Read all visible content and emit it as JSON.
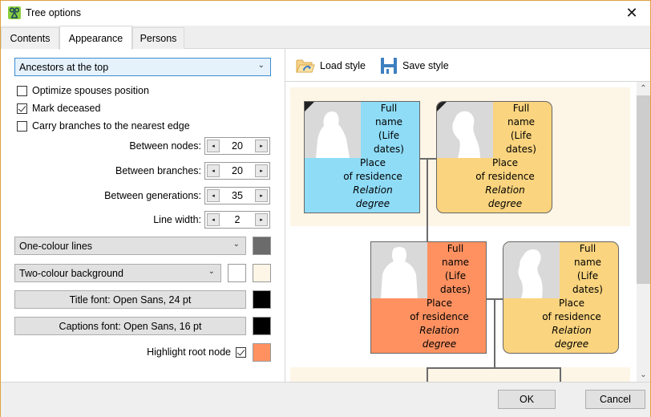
{
  "window": {
    "title": "Tree options",
    "close_glyph": "✕",
    "app_icon": "tree-options-app-icon"
  },
  "tabs": [
    {
      "label": "Contents",
      "active": false
    },
    {
      "label": "Appearance",
      "active": true
    },
    {
      "label": "Persons",
      "active": false
    }
  ],
  "appearance": {
    "layout_select": {
      "value": "Ancestors at the top"
    },
    "checkboxes": [
      {
        "label": "Optimize spouses position",
        "checked": false
      },
      {
        "label": "Mark deceased",
        "checked": true
      },
      {
        "label": "Carry branches to the nearest edge",
        "checked": false
      }
    ],
    "spinners": [
      {
        "label": "Between nodes:",
        "value": "20"
      },
      {
        "label": "Between branches:",
        "value": "20"
      },
      {
        "label": "Between generations:",
        "value": "35"
      },
      {
        "label": "Line width:",
        "value": "2"
      }
    ],
    "lines_select": {
      "value": "One-colour lines",
      "color": "#6b6b6b"
    },
    "background_select": {
      "value": "Two-colour background",
      "color1": "#ffffff",
      "color2": "#fdf5e6"
    },
    "title_font_button": {
      "label": "Title font: Open Sans, 24 pt",
      "color": "#000000"
    },
    "captions_font_button": {
      "label": "Captions font: Open Sans, 16 pt",
      "color": "#000000"
    },
    "highlight_root": {
      "label": "Highlight root node",
      "checked": true,
      "color": "#ff9161"
    }
  },
  "preview": {
    "toolbar": {
      "load_label": "Load style",
      "save_label": "Save style"
    },
    "node_text": {
      "line1": "Full",
      "line2": "name",
      "line3": "(Life",
      "line4": "dates)",
      "line5": "Place",
      "line6": "of residence",
      "line7": "Relation",
      "line8": "degree"
    },
    "colors": {
      "male": "#8fdcf7",
      "female": "#fad47e",
      "root": "#ff9161",
      "band": "#fdf5e6",
      "line": "#6b6b6b"
    },
    "scroll_up": "⌃",
    "scroll_down": "⌄"
  },
  "footer": {
    "ok_label": "OK",
    "cancel_label": "Cancel"
  }
}
